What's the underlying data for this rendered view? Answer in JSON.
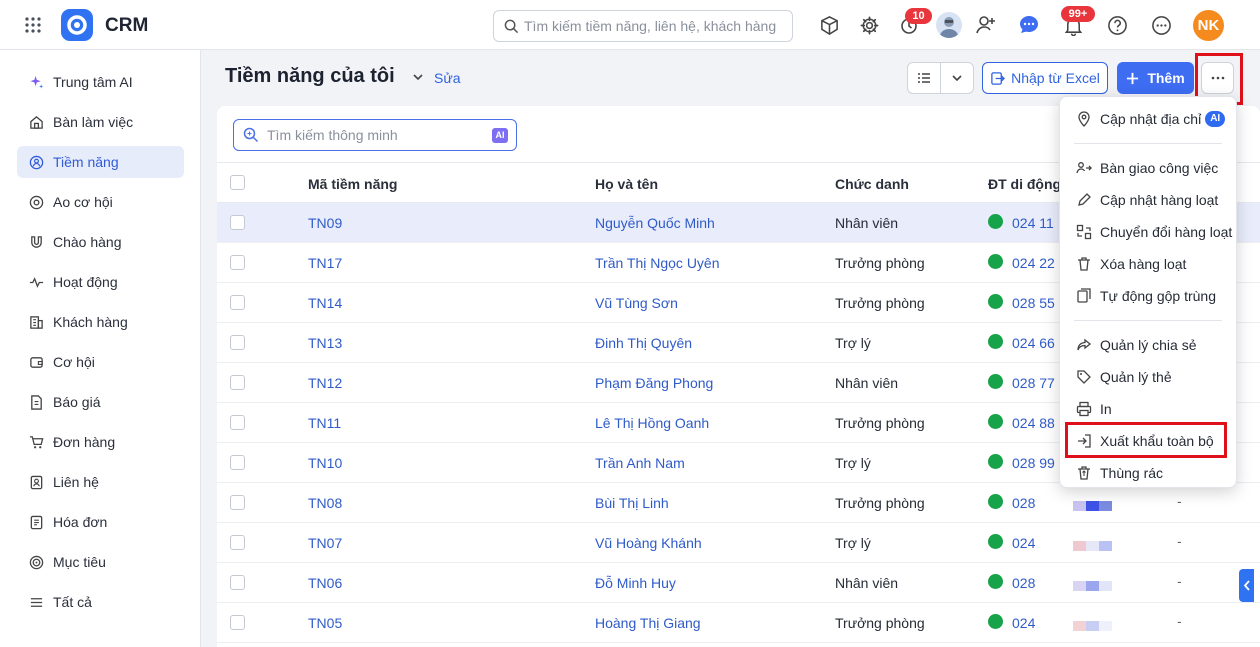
{
  "app": {
    "brand": "CRM"
  },
  "topbar": {
    "search_placeholder": "Tìm kiếm tiềm năng, liên hệ, khách hàng",
    "timer_badge": "10",
    "notif_badge": "99+",
    "avatar_initials": "NK",
    "colors": {
      "primary": "#3e6df2",
      "badge": "#e8363c",
      "avatar": "#f58b1f"
    }
  },
  "sidebar": {
    "items": [
      {
        "label": "Trung tâm AI",
        "icon": "sparkle-icon"
      },
      {
        "label": "Bàn làm việc",
        "icon": "home-icon"
      },
      {
        "label": "Tiềm năng",
        "icon": "prospect-icon",
        "active": true
      },
      {
        "label": "Ao cơ hội",
        "icon": "pond-icon"
      },
      {
        "label": "Chào hàng",
        "icon": "magnet-icon"
      },
      {
        "label": "Hoạt động",
        "icon": "activity-icon"
      },
      {
        "label": "Khách hàng",
        "icon": "building-icon"
      },
      {
        "label": "Cơ hội",
        "icon": "wallet-icon"
      },
      {
        "label": "Báo giá",
        "icon": "quote-icon"
      },
      {
        "label": "Đơn hàng",
        "icon": "cart-icon"
      },
      {
        "label": "Liên hệ",
        "icon": "contact-icon"
      },
      {
        "label": "Hóa đơn",
        "icon": "invoice-icon"
      },
      {
        "label": "Mục tiêu",
        "icon": "target-icon"
      },
      {
        "label": "Tất cả",
        "icon": "menu-icon"
      }
    ]
  },
  "page": {
    "title": "Tiềm năng của tôi",
    "edit_label": "Sửa",
    "import_label": "Nhập từ Excel",
    "add_label": "Thêm",
    "smart_search_placeholder": "Tìm kiếm thông minh",
    "ai_chip": "AI"
  },
  "table": {
    "columns": [
      "Mã tiềm năng",
      "Họ và tên",
      "Chức danh",
      "ĐT di động"
    ],
    "rows": [
      {
        "code": "TN09",
        "name": "Nguyễn Quốc Minh",
        "title": "Nhân viên",
        "phone": "024 11",
        "extra": ""
      },
      {
        "code": "TN17",
        "name": "Trần Thị Ngọc Uyên",
        "title": "Trưởng phòng",
        "phone": "024 22",
        "extra": ""
      },
      {
        "code": "TN14",
        "name": "Vũ Tùng Sơn",
        "title": "Trưởng phòng",
        "phone": "028 55",
        "extra": ""
      },
      {
        "code": "TN13",
        "name": "Đinh Thị Quyên",
        "title": "Trợ lý",
        "phone": "024 66",
        "extra": ""
      },
      {
        "code": "TN12",
        "name": "Phạm Đăng Phong",
        "title": "Nhân viên",
        "phone": "028 77",
        "extra": ""
      },
      {
        "code": "TN11",
        "name": "Lê Thị Hồng Oanh",
        "title": "Trưởng phòng",
        "phone": "024 88",
        "extra": ""
      },
      {
        "code": "TN10",
        "name": "Trần Anh Nam",
        "title": "Trợ lý",
        "phone": "028 99",
        "extra": ""
      },
      {
        "code": "TN08",
        "name": "Bùi Thị Linh",
        "title": "Trưởng phòng",
        "phone": "028",
        "extra": "-"
      },
      {
        "code": "TN07",
        "name": "Vũ Hoàng Khánh",
        "title": "Trợ lý",
        "phone": "024",
        "extra": "-"
      },
      {
        "code": "TN06",
        "name": "Đỗ Minh Huy",
        "title": "Nhân viên",
        "phone": "028",
        "extra": "-"
      },
      {
        "code": "TN05",
        "name": "Hoàng Thị Giang",
        "title": "Trưởng phòng",
        "phone": "024",
        "extra": "-"
      }
    ]
  },
  "dropdown": {
    "items": [
      {
        "label": "Cập nhật địa chỉ",
        "icon": "location-icon",
        "ai": "AI"
      },
      {
        "label": "Bàn giao công việc",
        "icon": "handover-icon"
      },
      {
        "label": "Cập nhật hàng loạt",
        "icon": "pencil-icon"
      },
      {
        "label": "Chuyển đổi hàng loạt",
        "icon": "convert-icon"
      },
      {
        "label": "Xóa hàng loạt",
        "icon": "trash-icon"
      },
      {
        "label": "Tự động gộp trùng",
        "icon": "merge-icon"
      },
      {
        "label": "Quản lý chia sẻ",
        "icon": "share-icon"
      },
      {
        "label": "Quản lý thẻ",
        "icon": "tag-icon"
      },
      {
        "label": "In",
        "icon": "printer-icon"
      },
      {
        "label": "Xuất khẩu toàn bộ",
        "icon": "export-icon",
        "highlighted": true
      },
      {
        "label": "Thùng rác",
        "icon": "recycle-bin-icon"
      }
    ]
  }
}
